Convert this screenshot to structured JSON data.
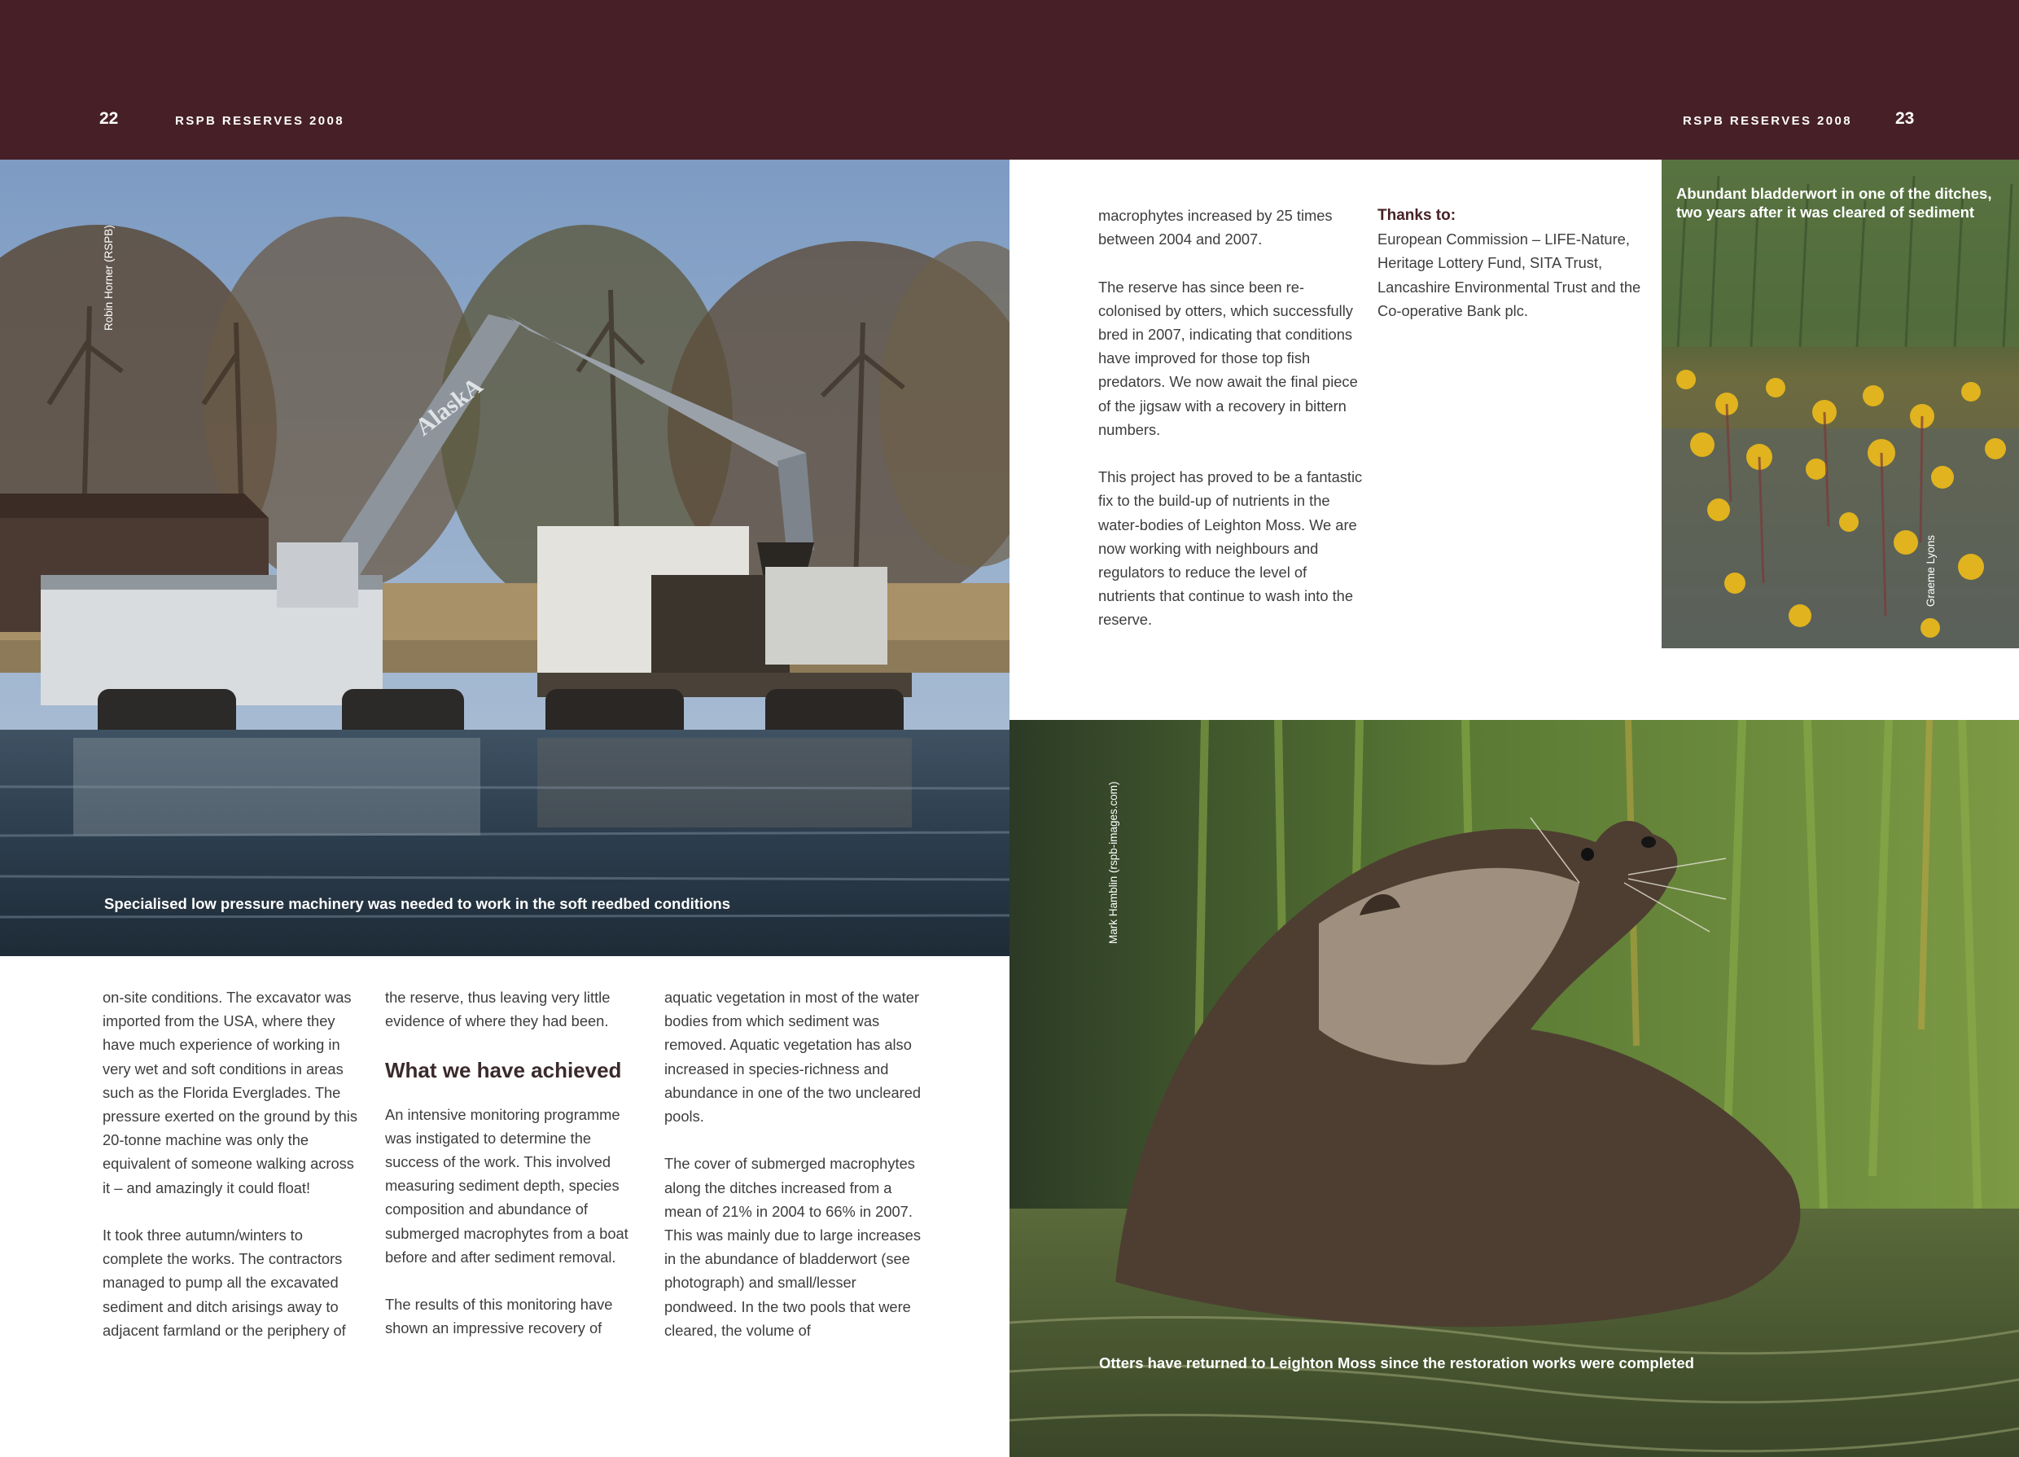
{
  "header": {
    "left_page_number": "22",
    "right_page_number": "23",
    "publication_left": "RSPB RESERVES 2008",
    "publication_right": "RSPB RESERVES 2008"
  },
  "photos": {
    "excavator": {
      "credit": "Robin Horner (RSPB)",
      "caption": "Specialised low pressure machinery was needed to work in the soft reedbed conditions",
      "machine_label": "AlaskA"
    },
    "bladderwort": {
      "credit": "Graeme Lyons",
      "caption": "Abundant bladderwort in one of the ditches, two years after it was cleared of sediment"
    },
    "otter": {
      "credit": "Mark Hamblin (rspb-images.com)",
      "caption": "Otters have returned to Leighton Moss since the restoration works were completed"
    }
  },
  "article": {
    "col1": {
      "p1": "on-site conditions. The excavator was imported from the USA, where they have much experience of working in very wet and soft conditions in areas such as the Florida Everglades. The pressure exerted on the ground by this 20-tonne machine was only the equivalent of someone walking across it – and amazingly it could float!",
      "p2": "It took three autumn/winters to complete the works. The contractors managed to pump all the excavated sediment and ditch arisings away to adjacent farmland or the periphery of"
    },
    "col2": {
      "p1": "the reserve, thus leaving very little evidence of where they had been.",
      "heading": "What we have achieved",
      "p2": "An intensive monitoring programme was instigated to determine the success of the work. This involved measuring sediment depth, species composition and abundance of submerged macrophytes from a boat before and after sediment removal.",
      "p3": "The results of this monitoring have shown an impressive recovery of"
    },
    "col3": {
      "p1": "aquatic vegetation in most of the water bodies from which sediment was removed. Aquatic vegetation has also increased in species-richness and abundance in one of the two uncleared pools.",
      "p2": "The cover of submerged macrophytes along the ditches increased from a mean of 21% in 2004 to 66% in 2007. This was mainly due to large increases in the abundance of bladderwort (see photograph) and small/lesser pondweed. In the two pools that were cleared, the volume of"
    },
    "col4": {
      "p1": "macrophytes increased by 25 times between 2004 and 2007.",
      "p2": "The reserve has since been re-colonised by otters, which successfully bred in 2007, indicating that conditions have improved for those top fish predators. We now await the final piece of the jigsaw with a recovery in bittern numbers.",
      "p3": "This project has proved to be a fantastic fix to the build-up of nutrients in the water-bodies of Leighton Moss. We are now working with neighbours and regulators to reduce the level of nutrients that continue to wash into the reserve."
    },
    "thanks": {
      "heading": "Thanks to:",
      "body": "European Commission – LIFE-Nature, Heritage Lottery Fund, SITA Trust, Lancashire Environmental Trust and the Co-operative Bank plc."
    }
  },
  "colors": {
    "header_band": "#462026",
    "body_text": "#3d3d3d",
    "heading_text": "#3a2a2c",
    "caption_text": "#ffffff"
  }
}
